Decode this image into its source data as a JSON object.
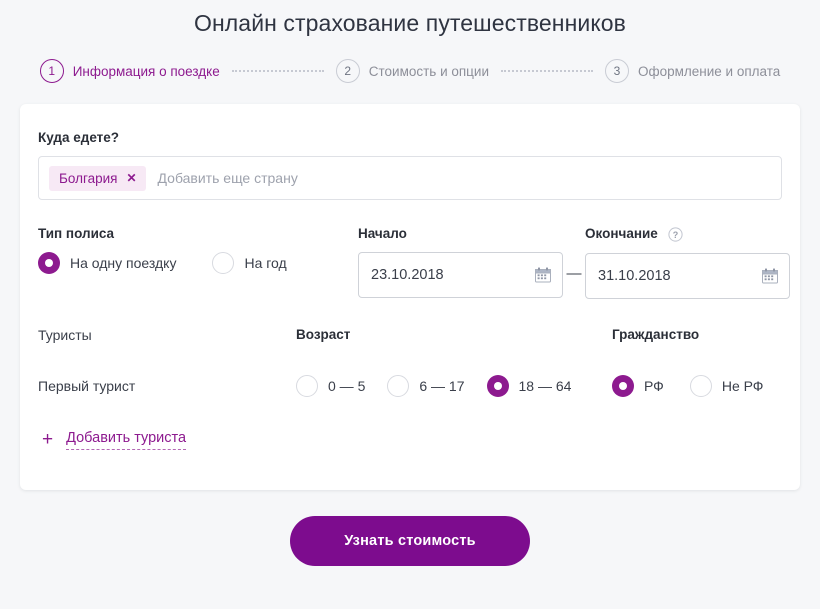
{
  "page": {
    "title": "Онлайн страхование путешественников"
  },
  "stepper": {
    "steps": [
      {
        "number": "1",
        "label": "Информация о поездке",
        "state": "active"
      },
      {
        "number": "2",
        "label": "Стоимость и опции",
        "state": "inactive"
      },
      {
        "number": "3",
        "label": "Оформление и оплата",
        "state": "inactive"
      }
    ]
  },
  "destination": {
    "label": "Куда едете?",
    "chips": [
      {
        "text": "Болгария",
        "close_icon": "close-icon"
      }
    ],
    "placeholder": "Добавить еще страну"
  },
  "policy": {
    "label": "Тип полиса",
    "options": [
      {
        "label": "На одну поездку",
        "selected": true
      },
      {
        "label": "На год",
        "selected": false
      }
    ]
  },
  "dates": {
    "start_label": "Начало",
    "start_value": "23.10.2018",
    "separator": "—",
    "end_label": "Окончание",
    "end_value": "31.10.2018",
    "end_help_icon": "help-circle-icon",
    "calendar_icon": "calendar-icon"
  },
  "tourists": {
    "name_header": "Туристы",
    "age_header": "Возраст",
    "citizenship_header": "Гражданство",
    "rows": [
      {
        "name": "Первый турист",
        "ages": [
          {
            "label": "0 — 5",
            "selected": false
          },
          {
            "label": "6 — 17",
            "selected": false
          },
          {
            "label": "18 — 64",
            "selected": true
          }
        ],
        "citizenship": [
          {
            "label": "РФ",
            "selected": true
          },
          {
            "label": "Не РФ",
            "selected": false
          }
        ]
      }
    ],
    "add_label": "Добавить туриста",
    "add_icon": "plus-icon"
  },
  "submit": {
    "label": "Узнать стоимость"
  },
  "colors": {
    "accent": "#8d1a8f",
    "button": "#7d0c8e",
    "chip_bg": "#f7e9f5",
    "page_bg": "#f6f7f9",
    "muted_text": "#8d8f99"
  }
}
